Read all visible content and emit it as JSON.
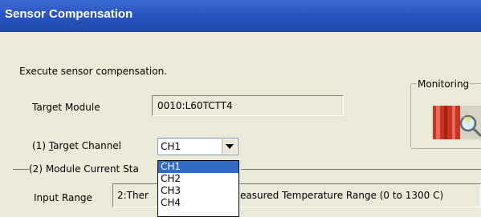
{
  "window": {
    "title": "Sensor Compensation"
  },
  "instruction": "Execute sensor compensation.",
  "monitoring_label": "Monitoring",
  "target_module": {
    "label": "Target Module",
    "value": "0010:L60TCTT4"
  },
  "target_channel": {
    "label_prefix": "(1) ",
    "label_key": "T",
    "label_rest": "arget Channel",
    "selected": "CH1",
    "options": [
      "CH1",
      "CH2",
      "CH3",
      "CH4"
    ]
  },
  "module_status": {
    "title": "(2) Module Current Sta"
  },
  "input_range": {
    "label": "Input Range",
    "value_prefix": "2:Ther",
    "value_suffix": "easured Temperature Range (0 to 1300 C)"
  },
  "colors": {
    "title_bar": "#2a56c0",
    "selection": "#316ac5",
    "dialog_bg": "#ece9d8"
  },
  "icons": [
    "monitoring-icon",
    "dropdown-arrow-icon"
  ]
}
